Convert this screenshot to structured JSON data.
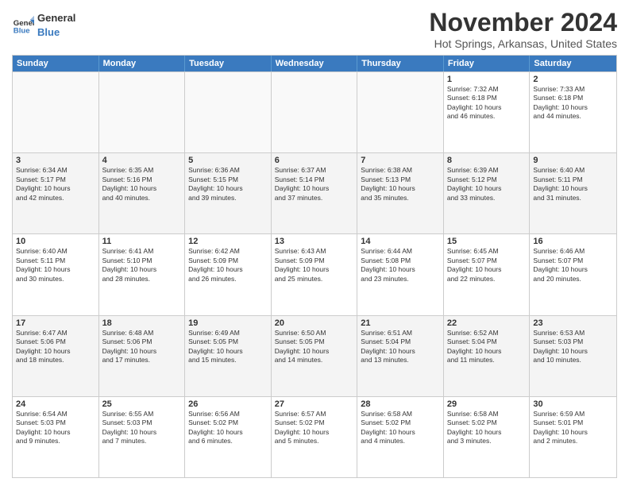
{
  "header": {
    "logo_line1": "General",
    "logo_line2": "Blue",
    "title": "November 2024",
    "location": "Hot Springs, Arkansas, United States"
  },
  "days_of_week": [
    "Sunday",
    "Monday",
    "Tuesday",
    "Wednesday",
    "Thursday",
    "Friday",
    "Saturday"
  ],
  "rows": [
    [
      {
        "day": "",
        "empty": true
      },
      {
        "day": "",
        "empty": true
      },
      {
        "day": "",
        "empty": true
      },
      {
        "day": "",
        "empty": true
      },
      {
        "day": "",
        "empty": true
      },
      {
        "day": "1",
        "info": "Sunrise: 7:32 AM\nSunset: 6:18 PM\nDaylight: 10 hours\nand 46 minutes."
      },
      {
        "day": "2",
        "info": "Sunrise: 7:33 AM\nSunset: 6:18 PM\nDaylight: 10 hours\nand 44 minutes."
      }
    ],
    [
      {
        "day": "3",
        "info": "Sunrise: 6:34 AM\nSunset: 5:17 PM\nDaylight: 10 hours\nand 42 minutes."
      },
      {
        "day": "4",
        "info": "Sunrise: 6:35 AM\nSunset: 5:16 PM\nDaylight: 10 hours\nand 40 minutes."
      },
      {
        "day": "5",
        "info": "Sunrise: 6:36 AM\nSunset: 5:15 PM\nDaylight: 10 hours\nand 39 minutes."
      },
      {
        "day": "6",
        "info": "Sunrise: 6:37 AM\nSunset: 5:14 PM\nDaylight: 10 hours\nand 37 minutes."
      },
      {
        "day": "7",
        "info": "Sunrise: 6:38 AM\nSunset: 5:13 PM\nDaylight: 10 hours\nand 35 minutes."
      },
      {
        "day": "8",
        "info": "Sunrise: 6:39 AM\nSunset: 5:12 PM\nDaylight: 10 hours\nand 33 minutes."
      },
      {
        "day": "9",
        "info": "Sunrise: 6:40 AM\nSunset: 5:11 PM\nDaylight: 10 hours\nand 31 minutes."
      }
    ],
    [
      {
        "day": "10",
        "info": "Sunrise: 6:40 AM\nSunset: 5:11 PM\nDaylight: 10 hours\nand 30 minutes."
      },
      {
        "day": "11",
        "info": "Sunrise: 6:41 AM\nSunset: 5:10 PM\nDaylight: 10 hours\nand 28 minutes."
      },
      {
        "day": "12",
        "info": "Sunrise: 6:42 AM\nSunset: 5:09 PM\nDaylight: 10 hours\nand 26 minutes."
      },
      {
        "day": "13",
        "info": "Sunrise: 6:43 AM\nSunset: 5:09 PM\nDaylight: 10 hours\nand 25 minutes."
      },
      {
        "day": "14",
        "info": "Sunrise: 6:44 AM\nSunset: 5:08 PM\nDaylight: 10 hours\nand 23 minutes."
      },
      {
        "day": "15",
        "info": "Sunrise: 6:45 AM\nSunset: 5:07 PM\nDaylight: 10 hours\nand 22 minutes."
      },
      {
        "day": "16",
        "info": "Sunrise: 6:46 AM\nSunset: 5:07 PM\nDaylight: 10 hours\nand 20 minutes."
      }
    ],
    [
      {
        "day": "17",
        "info": "Sunrise: 6:47 AM\nSunset: 5:06 PM\nDaylight: 10 hours\nand 18 minutes."
      },
      {
        "day": "18",
        "info": "Sunrise: 6:48 AM\nSunset: 5:06 PM\nDaylight: 10 hours\nand 17 minutes."
      },
      {
        "day": "19",
        "info": "Sunrise: 6:49 AM\nSunset: 5:05 PM\nDaylight: 10 hours\nand 15 minutes."
      },
      {
        "day": "20",
        "info": "Sunrise: 6:50 AM\nSunset: 5:05 PM\nDaylight: 10 hours\nand 14 minutes."
      },
      {
        "day": "21",
        "info": "Sunrise: 6:51 AM\nSunset: 5:04 PM\nDaylight: 10 hours\nand 13 minutes."
      },
      {
        "day": "22",
        "info": "Sunrise: 6:52 AM\nSunset: 5:04 PM\nDaylight: 10 hours\nand 11 minutes."
      },
      {
        "day": "23",
        "info": "Sunrise: 6:53 AM\nSunset: 5:03 PM\nDaylight: 10 hours\nand 10 minutes."
      }
    ],
    [
      {
        "day": "24",
        "info": "Sunrise: 6:54 AM\nSunset: 5:03 PM\nDaylight: 10 hours\nand 9 minutes."
      },
      {
        "day": "25",
        "info": "Sunrise: 6:55 AM\nSunset: 5:03 PM\nDaylight: 10 hours\nand 7 minutes."
      },
      {
        "day": "26",
        "info": "Sunrise: 6:56 AM\nSunset: 5:02 PM\nDaylight: 10 hours\nand 6 minutes."
      },
      {
        "day": "27",
        "info": "Sunrise: 6:57 AM\nSunset: 5:02 PM\nDaylight: 10 hours\nand 5 minutes."
      },
      {
        "day": "28",
        "info": "Sunrise: 6:58 AM\nSunset: 5:02 PM\nDaylight: 10 hours\nand 4 minutes."
      },
      {
        "day": "29",
        "info": "Sunrise: 6:58 AM\nSunset: 5:02 PM\nDaylight: 10 hours\nand 3 minutes."
      },
      {
        "day": "30",
        "info": "Sunrise: 6:59 AM\nSunset: 5:01 PM\nDaylight: 10 hours\nand 2 minutes."
      }
    ]
  ]
}
